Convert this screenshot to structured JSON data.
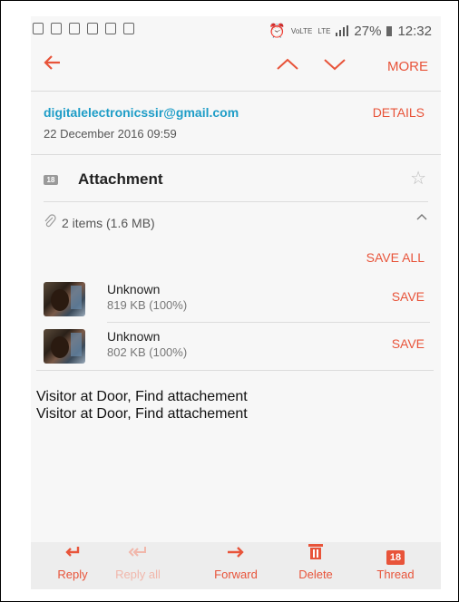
{
  "status_bar": {
    "signal_text": "VoLTE",
    "network": "LTE",
    "battery": "27%",
    "time": "12:32"
  },
  "toolbar": {
    "back_icon": "arrow-left-icon",
    "prev_icon": "chevron-up-icon",
    "next_icon": "chevron-down-icon",
    "more_label": "MORE"
  },
  "email": {
    "sender": "digitalelectronicssir@gmail.com",
    "details_label": "DETAILS",
    "date": "22 December 2016  09:59",
    "subject_badge": "18",
    "subject": "Attachment",
    "body_lines": [
      "Visitor at Door, Find attachement",
      "Visitor at Door, Find attachement"
    ]
  },
  "attachments": {
    "summary": "2 items (1.6 MB)",
    "save_all_label": "SAVE ALL",
    "items": [
      {
        "name": "Unknown",
        "size": "819 KB (100%)",
        "save_label": "SAVE"
      },
      {
        "name": "Unknown",
        "size": "802 KB (100%)",
        "save_label": "SAVE"
      }
    ]
  },
  "bottom_bar": {
    "reply": "Reply",
    "reply_all": "Reply all",
    "forward": "Forward",
    "delete": "Delete",
    "thread": "Thread",
    "thread_badge": "18"
  },
  "colors": {
    "accent": "#e8543a",
    "link": "#1e9dc7",
    "background": "#f7f7f7"
  }
}
